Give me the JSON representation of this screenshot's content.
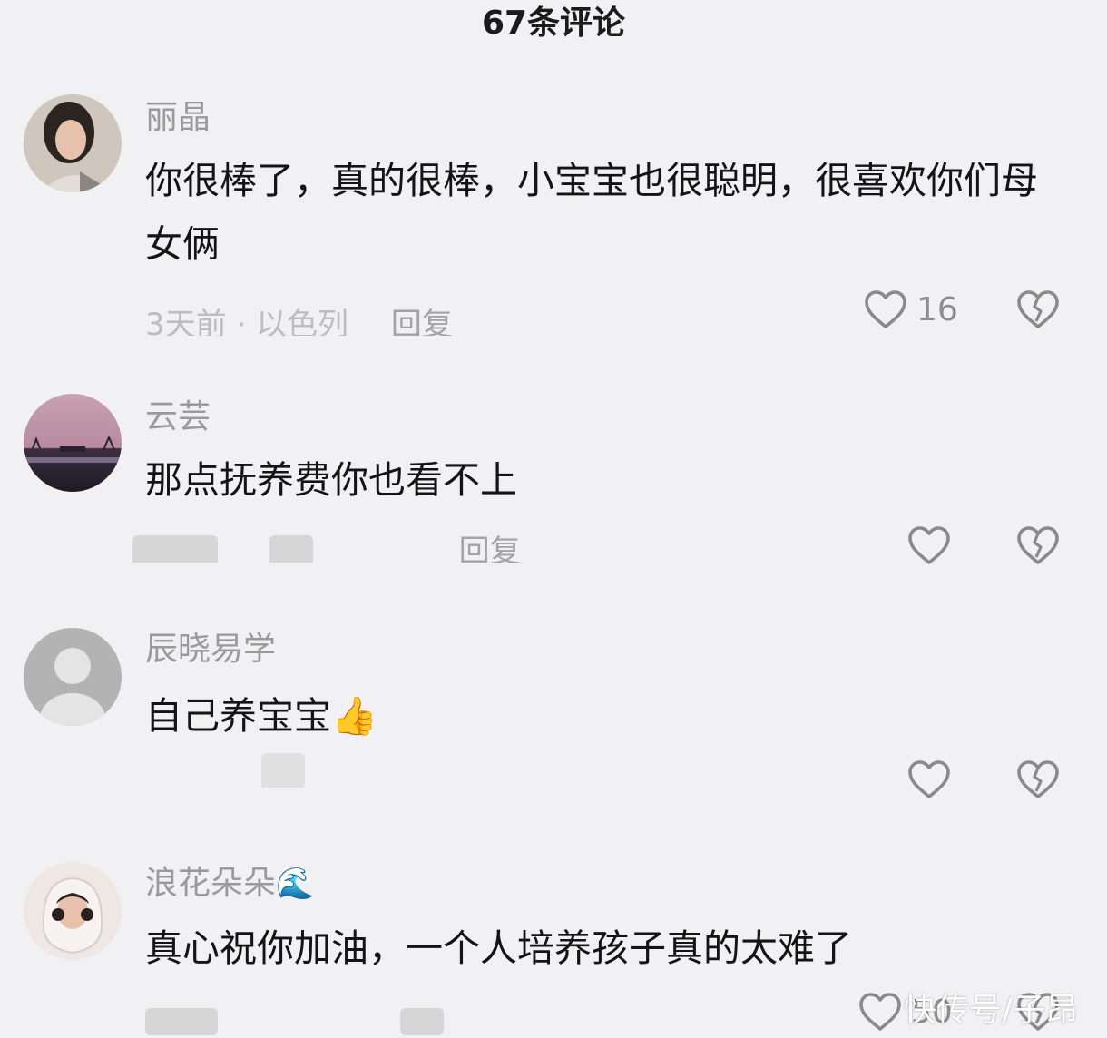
{
  "header": {
    "title": "67条评论"
  },
  "comments": [
    {
      "username": "丽晶",
      "text": "你很棒了，真的很棒，小宝宝也很聪明，很喜欢你们母女俩",
      "meta": "3天前 · 以色列",
      "reply": "回复",
      "likes": "16"
    },
    {
      "username": "云芸",
      "text": "那点抚养费你也看不上",
      "reply": "回复",
      "likes": ""
    },
    {
      "username": "辰晓易学",
      "text": "自己养宝宝",
      "text_emoji": "👍",
      "likes": ""
    },
    {
      "username": "浪花朵朵",
      "username_emoji": "🌊",
      "text": "真心祝你加油，一个人培养孩子真的太难了",
      "likes": "50"
    }
  ],
  "watermark": "快传号/子昂",
  "colors": {
    "background": "#f1f0f2",
    "username": "#9a9a9a",
    "icon": "#8a8a8a"
  },
  "icons": [
    "heart-outline-icon",
    "broken-heart-icon",
    "default-avatar-icon"
  ]
}
